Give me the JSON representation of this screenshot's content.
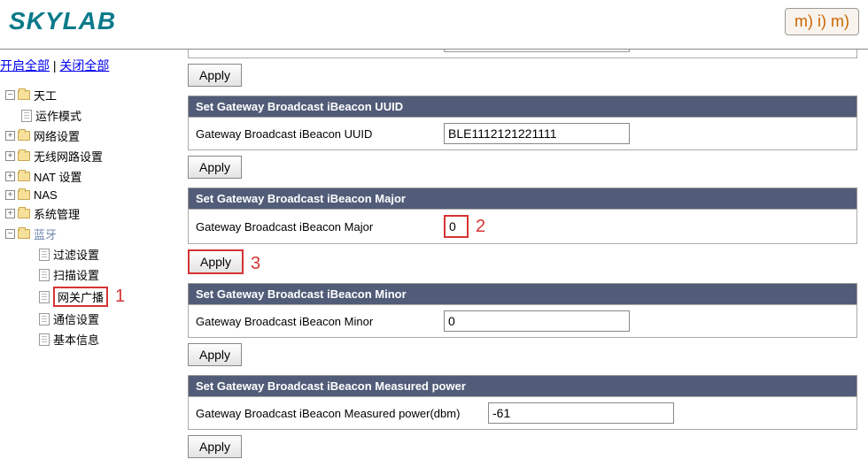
{
  "header": {
    "logo": "SKYLAB",
    "mim_logo": "m) i) m)"
  },
  "sidebar": {
    "toggle": {
      "open_all": "开启全部",
      "close_all": "关闭全部"
    },
    "items": [
      {
        "label": "天工",
        "type": "folder-root"
      },
      {
        "label": "运作模式",
        "type": "page"
      },
      {
        "label": "网络设置",
        "type": "folder-collapsed"
      },
      {
        "label": "无线网路设置",
        "type": "folder-collapsed"
      },
      {
        "label": "NAT 设置",
        "type": "folder-collapsed"
      },
      {
        "label": "NAS",
        "type": "folder-collapsed"
      },
      {
        "label": "系统管理",
        "type": "folder-collapsed"
      },
      {
        "label": "蓝牙",
        "type": "folder-expanded",
        "style": "bluetooth"
      },
      {
        "label": "过滤设置",
        "type": "page"
      },
      {
        "label": "扫描设置",
        "type": "page"
      },
      {
        "label": "网关广播",
        "type": "page"
      },
      {
        "label": "通信设置",
        "type": "page"
      },
      {
        "label": "基本信息",
        "type": "page"
      }
    ],
    "selected_index": 10
  },
  "content": {
    "top_apply": "Apply",
    "sections": [
      {
        "title": "Set Gateway Broadcast iBeacon UUID",
        "row_label": "Gateway Broadcast iBeacon UUID",
        "value": "BLE1112121221111",
        "apply": "Apply"
      },
      {
        "title": "Set Gateway Broadcast iBeacon Major",
        "row_label": "Gateway Broadcast iBeacon Major",
        "value": "0",
        "apply": "Apply"
      },
      {
        "title": "Set Gateway Broadcast iBeacon Minor",
        "row_label": "Gateway Broadcast iBeacon Minor",
        "value": "0",
        "apply": "Apply"
      },
      {
        "title": "Set Gateway Broadcast iBeacon Measured power",
        "row_label": "Gateway Broadcast iBeacon Measured power(dbm)",
        "value": "-61",
        "apply": "Apply"
      }
    ]
  },
  "annotations": {
    "ann1": "1",
    "ann2": "2",
    "ann3": "3"
  }
}
